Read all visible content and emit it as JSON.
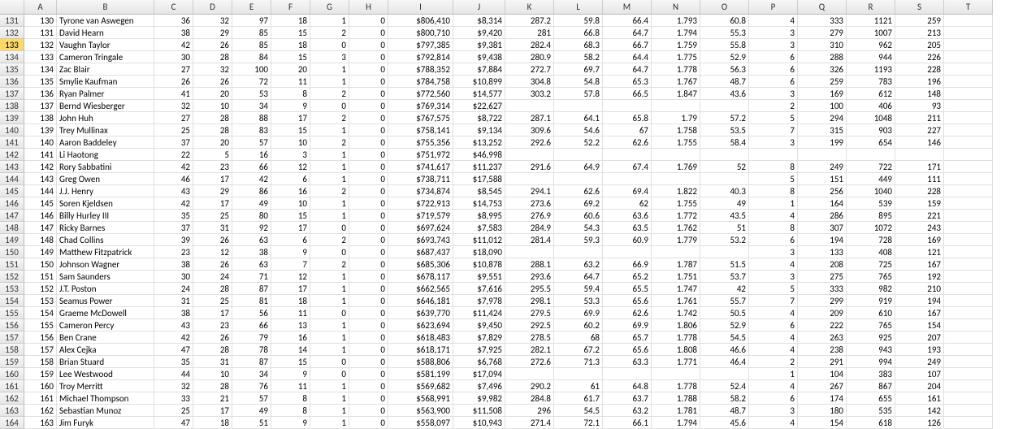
{
  "columns": [
    "",
    "A",
    "B",
    "C",
    "D",
    "E",
    "F",
    "G",
    "H",
    "I",
    "J",
    "K",
    "L",
    "M",
    "N",
    "O",
    "P",
    "Q",
    "R",
    "S",
    "T"
  ],
  "row_start": 131,
  "selected_row": 133,
  "chart_data": {
    "type": "table",
    "title": "",
    "rows": [
      {
        "A": 130,
        "B": "Tyrone van Aswegen",
        "C": 36,
        "D": 32,
        "E": 97,
        "F": 18,
        "G": 1,
        "H": 0,
        "I": "$806,410",
        "J": "$8,314",
        "K": 287.2,
        "L": 59.8,
        "M": 66.4,
        "N": 1.793,
        "O": 60.8,
        "P": 4,
        "Q": 333,
        "R": 1121,
        "S": 259,
        "T": ""
      },
      {
        "A": 131,
        "B": "David Hearn",
        "C": 38,
        "D": 29,
        "E": 85,
        "F": 15,
        "G": 2,
        "H": 0,
        "I": "$800,710",
        "J": "$9,420",
        "K": 281.0,
        "L": 66.8,
        "M": 64.7,
        "N": 1.794,
        "O": 55.3,
        "P": 3,
        "Q": 279,
        "R": 1007,
        "S": 213,
        "T": ""
      },
      {
        "A": 132,
        "B": "Vaughn Taylor",
        "C": 42,
        "D": 26,
        "E": 85,
        "F": 18,
        "G": 0,
        "H": 0,
        "I": "$797,385",
        "J": "$9,381",
        "K": 282.4,
        "L": 68.3,
        "M": 66.7,
        "N": 1.759,
        "O": 55.8,
        "P": 3,
        "Q": 310,
        "R": 962,
        "S": 205,
        "T": ""
      },
      {
        "A": 133,
        "B": "Cameron Tringale",
        "C": 30,
        "D": 28,
        "E": 84,
        "F": 15,
        "G": 3,
        "H": 0,
        "I": "$792,814",
        "J": "$9,438",
        "K": 280.9,
        "L": 58.2,
        "M": 64.4,
        "N": 1.775,
        "O": 52.9,
        "P": 6,
        "Q": 288,
        "R": 944,
        "S": 226,
        "T": ""
      },
      {
        "A": 134,
        "B": "Zac Blair",
        "C": 27,
        "D": 32,
        "E": 100,
        "F": 20,
        "G": 1,
        "H": 0,
        "I": "$788,352",
        "J": "$7,884",
        "K": 272.7,
        "L": 69.7,
        "M": 64.7,
        "N": 1.778,
        "O": 56.3,
        "P": 6,
        "Q": 326,
        "R": 1193,
        "S": 228,
        "T": ""
      },
      {
        "A": 135,
        "B": "Smylie Kaufman",
        "C": 26,
        "D": 26,
        "E": 72,
        "F": 11,
        "G": 1,
        "H": 0,
        "I": "$784,758",
        "J": "$10,899",
        "K": 304.8,
        "L": 54.8,
        "M": 65.3,
        "N": 1.767,
        "O": 48.7,
        "P": 6,
        "Q": 259,
        "R": 783,
        "S": 196,
        "T": ""
      },
      {
        "A": 136,
        "B": "Ryan Palmer",
        "C": 41,
        "D": 20,
        "E": 53,
        "F": 8,
        "G": 2,
        "H": 0,
        "I": "$772,560",
        "J": "$14,577",
        "K": 303.2,
        "L": 57.8,
        "M": 66.5,
        "N": 1.847,
        "O": 43.6,
        "P": 3,
        "Q": 169,
        "R": 612,
        "S": 148,
        "T": ""
      },
      {
        "A": 137,
        "B": "Bernd Wiesberger",
        "C": 32,
        "D": 10,
        "E": 34,
        "F": 9,
        "G": 0,
        "H": 0,
        "I": "$769,314",
        "J": "$22,627",
        "K": "",
        "L": "",
        "M": "",
        "N": "",
        "O": "",
        "P": 2,
        "Q": 100,
        "R": 406,
        "S": 93,
        "T": ""
      },
      {
        "A": 138,
        "B": "John Huh",
        "C": 27,
        "D": 28,
        "E": 88,
        "F": 17,
        "G": 2,
        "H": 0,
        "I": "$767,575",
        "J": "$8,722",
        "K": 287.1,
        "L": 64.1,
        "M": 65.8,
        "N": 1.79,
        "O": 57.2,
        "P": 5,
        "Q": 294,
        "R": 1048,
        "S": 211,
        "T": ""
      },
      {
        "A": 139,
        "B": "Trey Mullinax",
        "C": 25,
        "D": 28,
        "E": 83,
        "F": 15,
        "G": 1,
        "H": 0,
        "I": "$758,141",
        "J": "$9,134",
        "K": 309.6,
        "L": 54.6,
        "M": 67.0,
        "N": 1.758,
        "O": 53.5,
        "P": 7,
        "Q": 315,
        "R": 903,
        "S": 227,
        "T": ""
      },
      {
        "A": 140,
        "B": "Aaron Baddeley",
        "C": 37,
        "D": 20,
        "E": 57,
        "F": 10,
        "G": 2,
        "H": 0,
        "I": "$755,356",
        "J": "$13,252",
        "K": 292.6,
        "L": 52.2,
        "M": 62.6,
        "N": 1.755,
        "O": 58.4,
        "P": 3,
        "Q": 199,
        "R": 654,
        "S": 146,
        "T": ""
      },
      {
        "A": 141,
        "B": "Li Haotong",
        "C": 22,
        "D": 5,
        "E": 16,
        "F": 3,
        "G": 1,
        "H": 0,
        "I": "$751,972",
        "J": "$46,998",
        "K": "",
        "L": "",
        "M": "",
        "N": "",
        "O": "",
        "P": "",
        "Q": "",
        "R": "",
        "S": "",
        "T": ""
      },
      {
        "A": 142,
        "B": "Rory Sabbatini",
        "C": 42,
        "D": 23,
        "E": 66,
        "F": 12,
        "G": 1,
        "H": 0,
        "I": "$741,617",
        "J": "$11,237",
        "K": 291.6,
        "L": 64.9,
        "M": 67.4,
        "N": 1.769,
        "O": 52.0,
        "P": 8,
        "Q": 249,
        "R": 722,
        "S": 171,
        "T": ""
      },
      {
        "A": 143,
        "B": "Greg Owen",
        "C": 46,
        "D": 17,
        "E": 42,
        "F": 6,
        "G": 1,
        "H": 0,
        "I": "$738,711",
        "J": "$17,588",
        "K": "",
        "L": "",
        "M": "",
        "N": "",
        "O": "",
        "P": 5,
        "Q": 151,
        "R": 449,
        "S": 111,
        "T": ""
      },
      {
        "A": 144,
        "B": "J.J. Henry",
        "C": 43,
        "D": 29,
        "E": 86,
        "F": 16,
        "G": 2,
        "H": 0,
        "I": "$734,874",
        "J": "$8,545",
        "K": 294.1,
        "L": 62.6,
        "M": 69.4,
        "N": 1.822,
        "O": 40.3,
        "P": 8,
        "Q": 256,
        "R": 1040,
        "S": 228,
        "T": ""
      },
      {
        "A": 145,
        "B": "Soren Kjeldsen",
        "C": 42,
        "D": 17,
        "E": 49,
        "F": 10,
        "G": 1,
        "H": 0,
        "I": "$722,913",
        "J": "$14,753",
        "K": 273.6,
        "L": 69.2,
        "M": 62.0,
        "N": 1.755,
        "O": 49.0,
        "P": 1,
        "Q": 164,
        "R": 539,
        "S": 159,
        "T": ""
      },
      {
        "A": 146,
        "B": "Billy Hurley III",
        "C": 35,
        "D": 25,
        "E": 80,
        "F": 15,
        "G": 1,
        "H": 0,
        "I": "$719,579",
        "J": "$8,995",
        "K": 276.9,
        "L": 60.6,
        "M": 63.6,
        "N": 1.772,
        "O": 43.5,
        "P": 4,
        "Q": 286,
        "R": 895,
        "S": 221,
        "T": ""
      },
      {
        "A": 147,
        "B": "Ricky Barnes",
        "C": 37,
        "D": 31,
        "E": 92,
        "F": 17,
        "G": 0,
        "H": 0,
        "I": "$697,624",
        "J": "$7,583",
        "K": 284.9,
        "L": 54.3,
        "M": 63.5,
        "N": 1.762,
        "O": 51.0,
        "P": 8,
        "Q": 307,
        "R": 1072,
        "S": 243,
        "T": ""
      },
      {
        "A": 148,
        "B": "Chad Collins",
        "C": 39,
        "D": 26,
        "E": 63,
        "F": 6,
        "G": 2,
        "H": 0,
        "I": "$693,743",
        "J": "$11,012",
        "K": 281.4,
        "L": 59.3,
        "M": 60.9,
        "N": 1.779,
        "O": 53.2,
        "P": 6,
        "Q": 194,
        "R": 728,
        "S": 169,
        "T": ""
      },
      {
        "A": 149,
        "B": "Matthew Fitzpatrick",
        "C": 23,
        "D": 12,
        "E": 38,
        "F": 9,
        "G": 0,
        "H": 0,
        "I": "$687,437",
        "J": "$18,090",
        "K": "",
        "L": "",
        "M": "",
        "N": "",
        "O": "",
        "P": 3,
        "Q": 133,
        "R": 408,
        "S": 121,
        "T": ""
      },
      {
        "A": 150,
        "B": "Johnson Wagner",
        "C": 38,
        "D": 26,
        "E": 63,
        "F": 7,
        "G": 2,
        "H": 0,
        "I": "$685,306",
        "J": "$10,878",
        "K": 288.1,
        "L": 63.2,
        "M": 66.9,
        "N": 1.787,
        "O": 51.5,
        "P": 4,
        "Q": 208,
        "R": 725,
        "S": 167,
        "T": ""
      },
      {
        "A": 151,
        "B": "Sam Saunders",
        "C": 30,
        "D": 24,
        "E": 71,
        "F": 12,
        "G": 1,
        "H": 0,
        "I": "$678,117",
        "J": "$9,551",
        "K": 293.6,
        "L": 64.7,
        "M": 65.2,
        "N": 1.751,
        "O": 53.7,
        "P": 3,
        "Q": 275,
        "R": 765,
        "S": 192,
        "T": ""
      },
      {
        "A": 152,
        "B": "J.T. Poston",
        "C": 24,
        "D": 28,
        "E": 87,
        "F": 17,
        "G": 1,
        "H": 0,
        "I": "$662,565",
        "J": "$7,616",
        "K": 295.5,
        "L": 59.4,
        "M": 65.5,
        "N": 1.747,
        "O": 42.0,
        "P": 5,
        "Q": 333,
        "R": 982,
        "S": 210,
        "T": ""
      },
      {
        "A": 153,
        "B": "Seamus Power",
        "C": 31,
        "D": 25,
        "E": 81,
        "F": 18,
        "G": 1,
        "H": 0,
        "I": "$646,181",
        "J": "$7,978",
        "K": 298.1,
        "L": 53.3,
        "M": 65.6,
        "N": 1.761,
        "O": 55.7,
        "P": 7,
        "Q": 299,
        "R": 919,
        "S": 194,
        "T": ""
      },
      {
        "A": 154,
        "B": "Graeme McDowell",
        "C": 38,
        "D": 17,
        "E": 56,
        "F": 11,
        "G": 0,
        "H": 0,
        "I": "$639,770",
        "J": "$11,424",
        "K": 279.5,
        "L": 69.9,
        "M": 62.6,
        "N": 1.742,
        "O": 50.5,
        "P": 4,
        "Q": 209,
        "R": 610,
        "S": 167,
        "T": ""
      },
      {
        "A": 155,
        "B": "Cameron Percy",
        "C": 43,
        "D": 23,
        "E": 66,
        "F": 13,
        "G": 1,
        "H": 0,
        "I": "$623,694",
        "J": "$9,450",
        "K": 292.5,
        "L": 60.2,
        "M": 69.9,
        "N": 1.806,
        "O": 52.9,
        "P": 6,
        "Q": 222,
        "R": 765,
        "S": 154,
        "T": ""
      },
      {
        "A": 156,
        "B": "Ben Crane",
        "C": 42,
        "D": 26,
        "E": 79,
        "F": 16,
        "G": 1,
        "H": 0,
        "I": "$618,483",
        "J": "$7,829",
        "K": 278.5,
        "L": 68.0,
        "M": 65.7,
        "N": 1.778,
        "O": 54.5,
        "P": 4,
        "Q": 263,
        "R": 925,
        "S": 207,
        "T": ""
      },
      {
        "A": 157,
        "B": "Alex Cejka",
        "C": 47,
        "D": 28,
        "E": 78,
        "F": 14,
        "G": 1,
        "H": 0,
        "I": "$618,171",
        "J": "$7,925",
        "K": 282.1,
        "L": 67.2,
        "M": 65.6,
        "N": 1.808,
        "O": 46.6,
        "P": 4,
        "Q": 238,
        "R": 943,
        "S": 193,
        "T": ""
      },
      {
        "A": 158,
        "B": "Brian Stuard",
        "C": 35,
        "D": 31,
        "E": 87,
        "F": 15,
        "G": 0,
        "H": 0,
        "I": "$588,806",
        "J": "$6,768",
        "K": 272.6,
        "L": 71.3,
        "M": 63.3,
        "N": 1.771,
        "O": 46.4,
        "P": 2,
        "Q": 291,
        "R": 994,
        "S": 249,
        "T": ""
      },
      {
        "A": 159,
        "B": "Lee Westwood",
        "C": 44,
        "D": 10,
        "E": 34,
        "F": 9,
        "G": 0,
        "H": 0,
        "I": "$581,199",
        "J": "$17,094",
        "K": "",
        "L": "",
        "M": "",
        "N": "",
        "O": "",
        "P": 1,
        "Q": 104,
        "R": 383,
        "S": 107,
        "T": ""
      },
      {
        "A": 160,
        "B": "Troy Merritt",
        "C": 32,
        "D": 28,
        "E": 76,
        "F": 11,
        "G": 1,
        "H": 0,
        "I": "$569,682",
        "J": "$7,496",
        "K": 290.2,
        "L": 61.0,
        "M": 64.8,
        "N": 1.778,
        "O": 52.4,
        "P": 4,
        "Q": 267,
        "R": 867,
        "S": 204,
        "T": ""
      },
      {
        "A": 161,
        "B": "Michael Thompson",
        "C": 33,
        "D": 21,
        "E": 57,
        "F": 8,
        "G": 1,
        "H": 0,
        "I": "$568,991",
        "J": "$9,982",
        "K": 284.8,
        "L": 61.7,
        "M": 63.7,
        "N": 1.788,
        "O": 58.2,
        "P": 6,
        "Q": 174,
        "R": 655,
        "S": 161,
        "T": ""
      },
      {
        "A": 162,
        "B": "Sebastian Munoz",
        "C": 25,
        "D": 17,
        "E": 49,
        "F": 8,
        "G": 1,
        "H": 0,
        "I": "$563,900",
        "J": "$11,508",
        "K": 296.0,
        "L": 54.5,
        "M": 63.2,
        "N": 1.781,
        "O": 48.7,
        "P": 3,
        "Q": 180,
        "R": 535,
        "S": 142,
        "T": ""
      },
      {
        "A": 163,
        "B": "Jim Furyk",
        "C": 47,
        "D": 18,
        "E": 51,
        "F": 9,
        "G": 1,
        "H": 0,
        "I": "$558,097",
        "J": "$10,943",
        "K": 271.4,
        "L": 72.1,
        "M": 66.1,
        "N": 1.794,
        "O": 45.6,
        "P": 4,
        "Q": 154,
        "R": 618,
        "S": 126,
        "T": ""
      }
    ]
  }
}
